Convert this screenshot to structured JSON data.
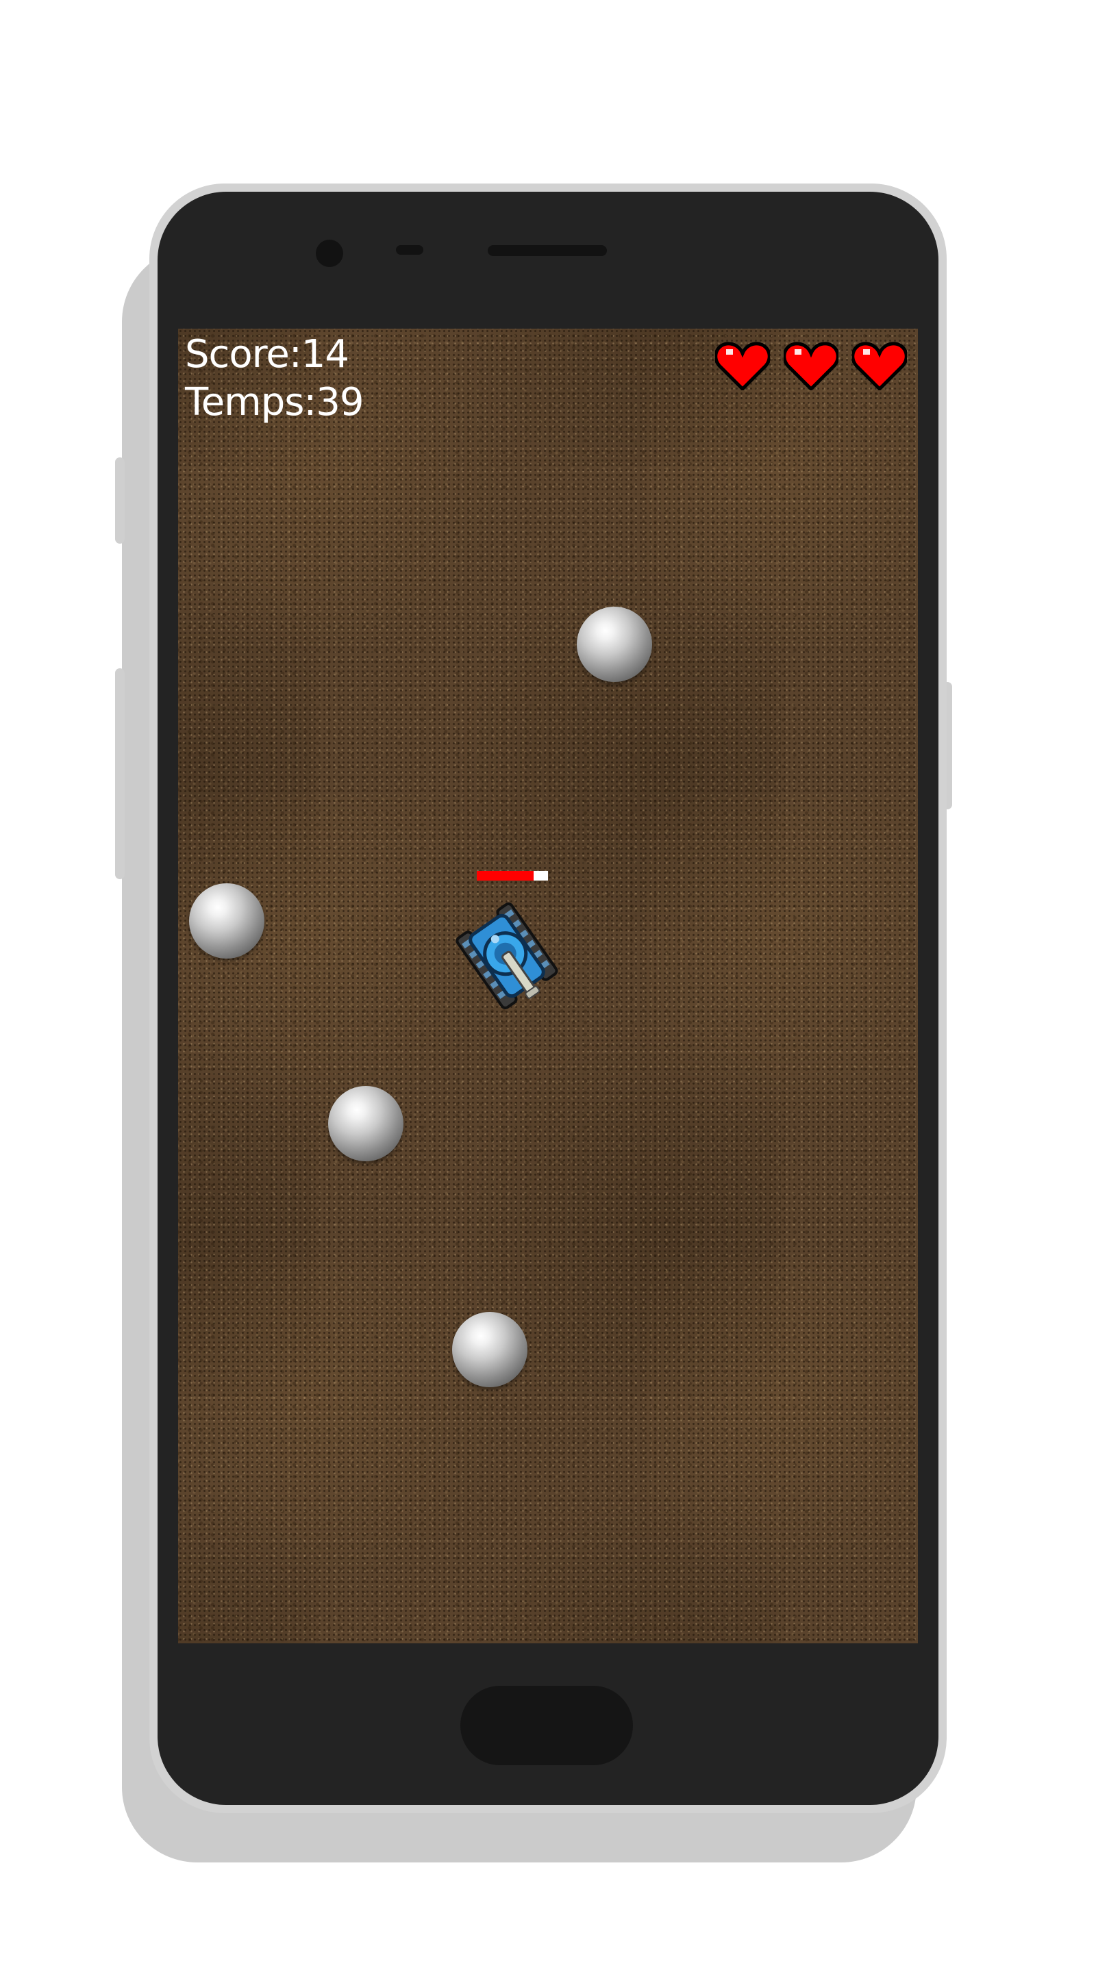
{
  "game": {
    "score_text": "Score:14",
    "time_text": "Temps:39",
    "lives": 3,
    "player_health": 0.8
  },
  "icons": {
    "heart": "heart-icon",
    "enemy": "steel-ball",
    "player": "blue-tank"
  },
  "colors": {
    "heart": "#ff0000",
    "health_fill": "#ff0000",
    "health_empty": "#ffffff",
    "hud_text": "#ffffff",
    "tank": "#2f8fd6",
    "ground": "#5a432c"
  }
}
